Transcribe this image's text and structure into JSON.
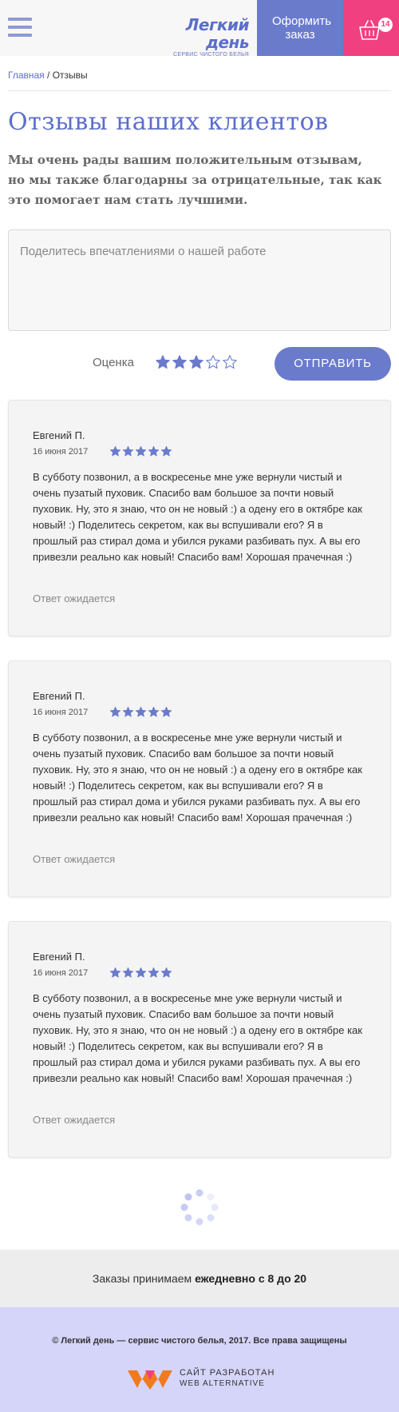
{
  "header": {
    "logo_title": "Легкий день",
    "logo_subtitle": "сервис чистого белья",
    "order_button": "Оформить заказ",
    "cart_count": "14",
    "accent_color": "#6b7bcc",
    "cart_color": "#f0407f"
  },
  "breadcrumb": {
    "home": "Главная",
    "separator": " / ",
    "current": "Отзывы"
  },
  "page": {
    "title": "Отзывы наших клиентов",
    "intro": "Мы очень рады вашим положительным отзывам, но мы также благодарны за отрицательные, так как это помогает нам стать лучшими."
  },
  "form": {
    "placeholder": "Поделитесь впечатлениями о нашей работе",
    "rating_label": "Оценка",
    "rating_value": 3,
    "rating_max": 5,
    "submit_label": "Отправить"
  },
  "reviews": [
    {
      "author": "Евгений П.",
      "date": "16 июня 2017",
      "rating": 5,
      "text": "В субботу позвонил, а в воскресенье мне уже вернули чистый и очень пузатый пуховик. Спасибо вам большое за почти новый пуховик. Ну, это я знаю, что он не новый :) а одену его в октябре как новый! :) Поделитесь секретом, как вы вспушивали его? Я в прошлый раз стирал дома и убился руками разбивать пух. А вы его привезли реально как новый! Спасибо вам! Хорошая прачечная :)",
      "status": "Ответ ожидается"
    },
    {
      "author": "Евгений П.",
      "date": "16 июня 2017",
      "rating": 5,
      "text": "В субботу позвонил, а в воскресенье мне уже вернули чистый и очень пузатый пуховик. Спасибо вам большое за почти новый пуховик. Ну, это я знаю, что он не новый :) а одену его в октябре как новый! :) Поделитесь секретом, как вы вспушивали его? Я в прошлый раз стирал дома и убился руками разбивать пух. А вы его привезли реально как новый! Спасибо вам! Хорошая прачечная :)",
      "status": "Ответ ожидается"
    },
    {
      "author": "Евгений П.",
      "date": "16 июня 2017",
      "rating": 5,
      "text": "В субботу позвонил, а в воскресенье мне уже вернули чистый и очень пузатый пуховик. Спасибо вам большое за почти новый пуховик. Ну, это я знаю, что он не новый :) а одену его в октябре как новый! :) Поделитесь секретом, как вы вспушивали его? Я в прошлый раз стирал дома и убился руками разбивать пух. А вы его привезли реально как новый! Спасибо вам! Хорошая прачечная :)",
      "status": "Ответ ожидается"
    }
  ],
  "footer": {
    "hours_prefix": "Заказы  принимаем ",
    "hours_bold": "ежедневно с 8 до 20",
    "copyright": "© Легкий день — сервис чистого белья, 2017. Все права защищены",
    "dev_line1": "САЙТ РАЗРАБОТАН",
    "dev_line2": "WEB ALTERNATIVE"
  }
}
